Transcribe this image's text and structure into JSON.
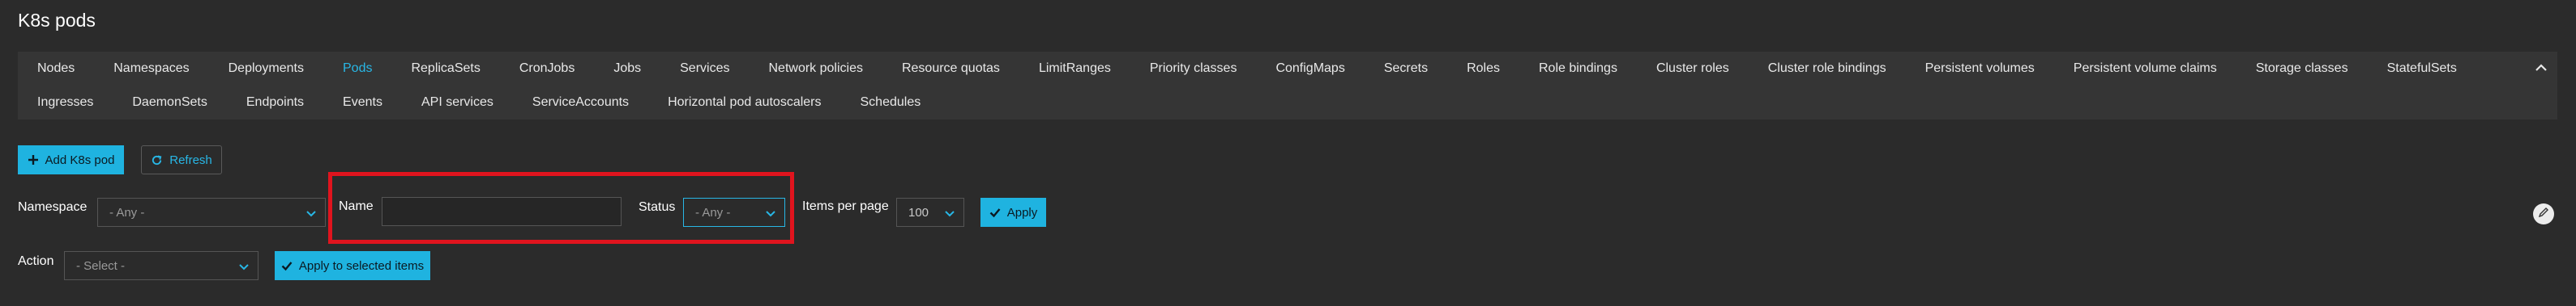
{
  "page": {
    "title": "K8s pods"
  },
  "tabs": {
    "row1": [
      "Nodes",
      "Namespaces",
      "Deployments",
      "Pods",
      "ReplicaSets",
      "CronJobs",
      "Jobs",
      "Services",
      "Network policies",
      "Resource quotas",
      "LimitRanges",
      "Priority classes",
      "ConfigMaps",
      "Secrets",
      "Roles",
      "Role bindings",
      "Cluster roles",
      "Cluster role bindings",
      "Persistent volumes",
      "Persistent volume claims",
      "Storage classes",
      "StatefulSets"
    ],
    "row2": [
      "Ingresses",
      "DaemonSets",
      "Endpoints",
      "Events",
      "API services",
      "ServiceAccounts",
      "Horizontal pod autoscalers",
      "Schedules"
    ],
    "active": "Pods"
  },
  "toolbar": {
    "add_label": "Add K8s pod",
    "refresh_label": "Refresh"
  },
  "filters": {
    "namespace_label": "Namespace",
    "namespace_value": "- Any -",
    "name_label": "Name",
    "name_value": "",
    "status_label": "Status",
    "status_value": "- Any -",
    "items_per_page_label": "Items per page",
    "items_per_page_value": "100",
    "apply_label": "Apply"
  },
  "bulk": {
    "action_label": "Action",
    "action_value": "- Select -",
    "apply_selected_label": "Apply to selected items"
  },
  "colors": {
    "accent": "#1fb3e0",
    "active_tab": "#28b7e6",
    "highlight": "#e0141e",
    "background": "#2b2b2b"
  }
}
